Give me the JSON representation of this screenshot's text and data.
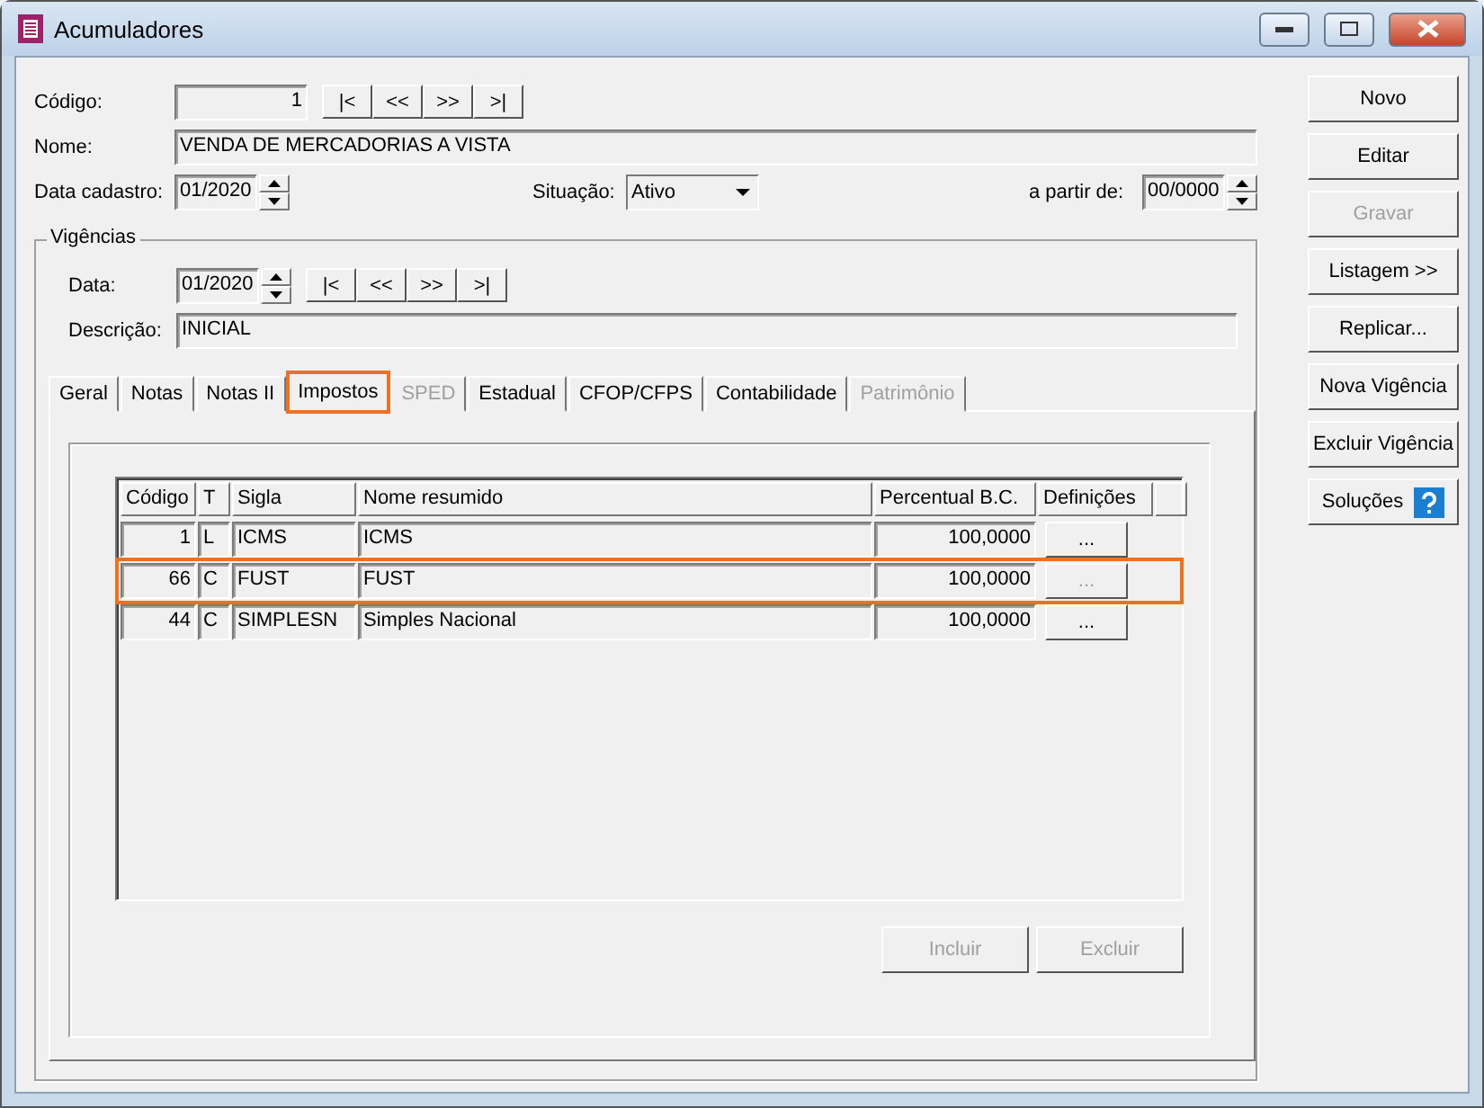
{
  "window": {
    "title": "Acumuladores"
  },
  "form": {
    "codigo": {
      "label": "Código:",
      "value": "1"
    },
    "nav_buttons": [
      "|<",
      "<<",
      ">>",
      ">|"
    ],
    "nome": {
      "label": "Nome:",
      "value": "VENDA DE MERCADORIAS A VISTA"
    },
    "data_cadastro": {
      "label": "Data cadastro:",
      "value": "01/2020"
    },
    "situacao": {
      "label": "Situação:",
      "value": "Ativo"
    },
    "a_partir_de": {
      "label": "a partir de:",
      "value": "00/0000"
    }
  },
  "vigencias": {
    "title": "Vigências",
    "data": {
      "label": "Data:",
      "value": "01/2020"
    },
    "nav_buttons": [
      "|<",
      "<<",
      ">>",
      ">|"
    ],
    "descricao": {
      "label": "Descrição:",
      "value": "INICIAL"
    }
  },
  "tabs": [
    {
      "label": "Geral",
      "selected": false,
      "disabled": false,
      "highlighted": false
    },
    {
      "label": "Notas",
      "selected": false,
      "disabled": false,
      "highlighted": false
    },
    {
      "label": "Notas II",
      "selected": false,
      "disabled": false,
      "highlighted": false
    },
    {
      "label": "Impostos",
      "selected": true,
      "disabled": false,
      "highlighted": true
    },
    {
      "label": "SPED",
      "selected": false,
      "disabled": true,
      "highlighted": false
    },
    {
      "label": "Estadual",
      "selected": false,
      "disabled": false,
      "highlighted": false
    },
    {
      "label": "CFOP/CFPS",
      "selected": false,
      "disabled": false,
      "highlighted": false
    },
    {
      "label": "Contabilidade",
      "selected": false,
      "disabled": false,
      "highlighted": false
    },
    {
      "label": "Patrimônio",
      "selected": false,
      "disabled": true,
      "highlighted": false
    }
  ],
  "table": {
    "columns": [
      "Código",
      "T",
      "Sigla",
      "Nome resumido",
      "Percentual B.C.",
      "Definições"
    ],
    "rows": [
      {
        "codigo": "1",
        "t": "L",
        "sigla": "ICMS",
        "nome": "ICMS",
        "percentual": "100,0000",
        "definicoes": "...",
        "definicoes_disabled": false,
        "highlighted": false
      },
      {
        "codigo": "66",
        "t": "C",
        "sigla": "FUST",
        "nome": "FUST",
        "percentual": "100,0000",
        "definicoes": "...",
        "definicoes_disabled": true,
        "highlighted": true
      },
      {
        "codigo": "44",
        "t": "C",
        "sigla": "SIMPLESN",
        "nome": "Simples Nacional",
        "percentual": "100,0000",
        "definicoes": "...",
        "definicoes_disabled": false,
        "highlighted": false
      }
    ]
  },
  "table_buttons": [
    {
      "label": "Incluir",
      "disabled": true
    },
    {
      "label": "Excluir",
      "disabled": true
    }
  ],
  "side_buttons": [
    {
      "label": "Novo",
      "disabled": false,
      "kind": "plain"
    },
    {
      "label": "Editar",
      "disabled": false,
      "kind": "plain"
    },
    {
      "label": "Gravar",
      "disabled": true,
      "kind": "plain"
    },
    {
      "label": "Listagem >>",
      "disabled": false,
      "kind": "plain"
    },
    {
      "label": "Replicar...",
      "disabled": false,
      "kind": "plain"
    },
    {
      "label": "Nova Vigência",
      "disabled": false,
      "kind": "plain"
    },
    {
      "label": "Excluir Vigência",
      "disabled": false,
      "kind": "plain"
    },
    {
      "label": "Soluções",
      "disabled": false,
      "kind": "help"
    }
  ]
}
